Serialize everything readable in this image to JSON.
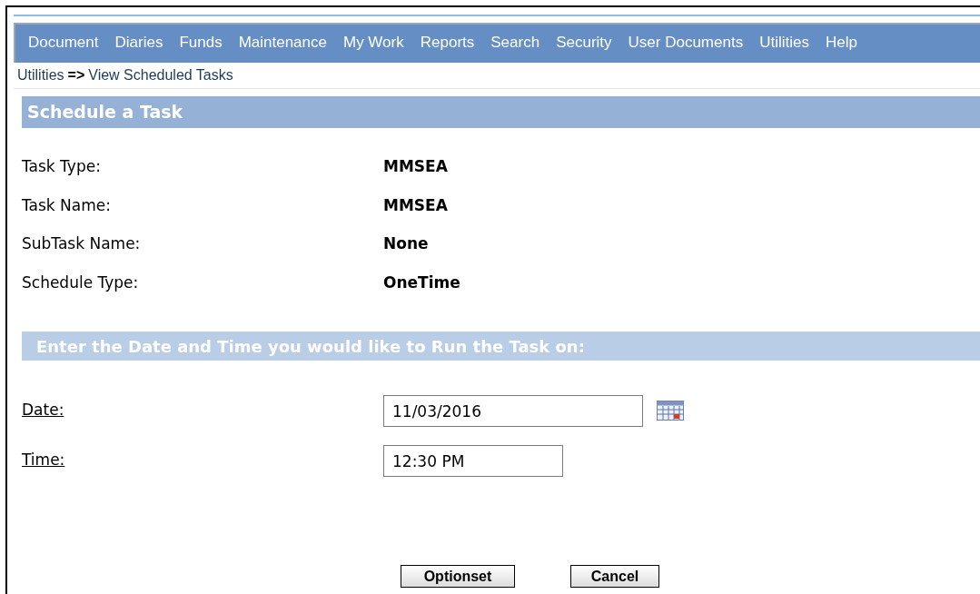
{
  "menu": [
    "Document",
    "Diaries",
    "Funds",
    "Maintenance",
    "My Work",
    "Reports",
    "Search",
    "Security",
    "User Documents",
    "Utilities",
    "Help"
  ],
  "breadcrumb": {
    "parent": "Utilities",
    "separator": "=>",
    "current": "View Scheduled Tasks"
  },
  "section_title": "Schedule a Task",
  "details": [
    {
      "label": "Task Type:",
      "value": "MMSEA"
    },
    {
      "label": "Task Name:",
      "value": "MMSEA"
    },
    {
      "label": "SubTask Name:",
      "value": "None"
    },
    {
      "label": "Schedule Type:",
      "value": "OneTime"
    }
  ],
  "run_title": "Enter the Date and Time you would like to Run the Task on:",
  "fields": [
    {
      "kind": "date",
      "label": "Date:",
      "value": "11/03/2016"
    },
    {
      "kind": "time",
      "label": "Time:",
      "value": "12:30 PM"
    }
  ],
  "buttons": [
    "Optionset",
    "Cancel"
  ]
}
